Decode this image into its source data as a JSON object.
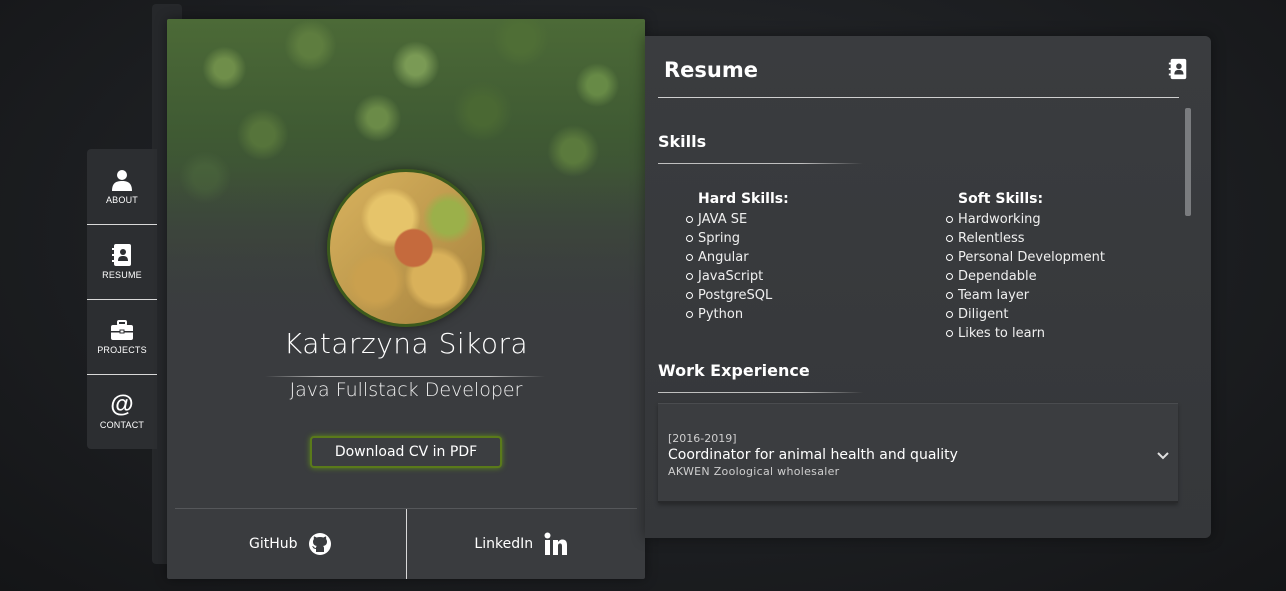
{
  "sidenav": {
    "items": [
      {
        "label": "ABOUT",
        "icon": "person-icon"
      },
      {
        "label": "RESUME",
        "icon": "contact-book-icon"
      },
      {
        "label": "PROJECTS",
        "icon": "briefcase-icon"
      },
      {
        "label": "CONTACT",
        "icon": "at-sign-icon"
      }
    ],
    "contact_symbol": "@"
  },
  "profile": {
    "name": "Katarzyna Sikora",
    "subtitle": "Java Fullstack Developer",
    "download_label": "Download CV in PDF",
    "github_label": "GitHub",
    "linkedin_label": "LinkedIn",
    "accent_color": "#5a7a1a"
  },
  "resume": {
    "title": "Resume",
    "skills": {
      "title": "Skills",
      "hard_title": "Hard Skills:",
      "hard": [
        "JAVA SE",
        "Spring",
        "Angular",
        "JavaScript",
        "PostgreSQL",
        "Python"
      ],
      "soft_title": "Soft Skills:",
      "soft": [
        "Hardworking",
        "Relentless",
        "Personal Development",
        "Dependable",
        "Team layer",
        "Diligent",
        "Likes to learn"
      ]
    },
    "work": {
      "title": "Work Experience",
      "jobs": [
        {
          "date": "[2016-2019]",
          "title": "Coordinator for animal health and quality",
          "company": "AKWEN Zoological wholesaler"
        }
      ]
    }
  }
}
